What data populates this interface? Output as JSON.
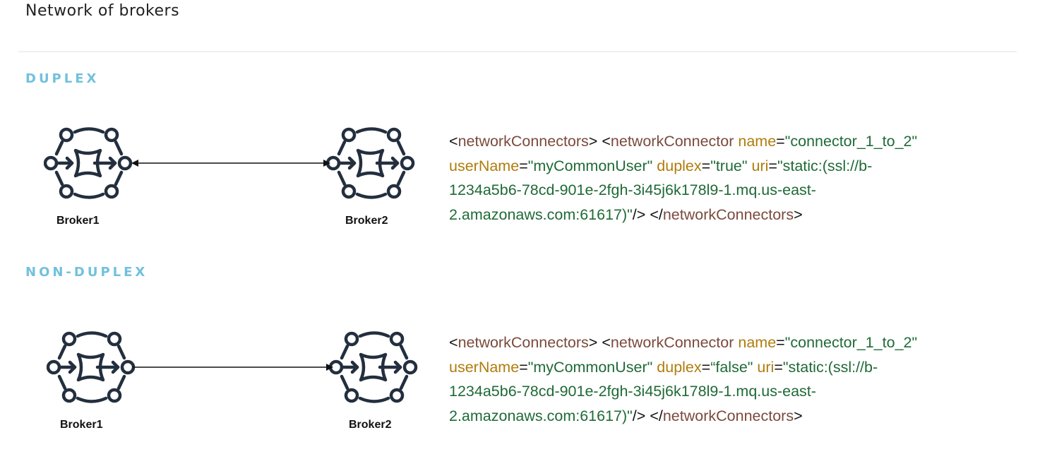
{
  "title": "Network of brokers",
  "sections": [
    {
      "heading": "DUPLEX",
      "broker_a": "Broker1",
      "broker_b": "Broker2",
      "connection": "bidirectional",
      "code": {
        "open_outer": "<networkConnectors>",
        "open_tag_lt": "<",
        "tag": "networkConnector",
        "attr_name": "name",
        "eq": "=",
        "val_name": "\"connector_1_to_2\"",
        "attr_user": "userName",
        "val_user": "\"myCommonUser\"",
        "attr_duplex": "duplex",
        "val_duplex": "\"true\"",
        "attr_uri": "uri",
        "val_uri_1": "\"static:(ssl://b-",
        "val_uri_2": "1234a5b6-78cd-901e-2fgh-3i45j6k178l9-1.mq.us-east-",
        "val_uri_3": "2.amazonaws.com:61617)\"",
        "self_close": "/>",
        "close_lt": "</",
        "close_tag": "networkConnectors",
        "gt": ">"
      }
    },
    {
      "heading": "NON-DUPLEX",
      "broker_a": "Broker1",
      "broker_b": "Broker2",
      "connection": "one-way",
      "code": {
        "open_outer": "<networkConnectors>",
        "open_tag_lt": "<",
        "tag": "networkConnector",
        "attr_name": "name",
        "eq": "=",
        "val_name": "\"connector_1_to_2\"",
        "attr_user": "userName",
        "val_user": "\"myCommonUser\"",
        "attr_duplex": "duplex",
        "val_duplex": "“false\"",
        "attr_uri": "uri",
        "val_uri_1": "\"static:(ssl://b-",
        "val_uri_2": "1234a5b6-78cd-901e-2fgh-3i45j6k178l9-1.mq.us-east-",
        "val_uri_3": "2.amazonaws.com:61617)\"",
        "self_close": "/>",
        "close_lt": "</",
        "close_tag": "networkConnectors",
        "gt": ">"
      }
    }
  ],
  "colors": {
    "heading": "#72c1dc",
    "tag": "#7b4a3c",
    "attr": "#b07c0c",
    "value": "#1f6a36",
    "icon": "#232f3e"
  }
}
